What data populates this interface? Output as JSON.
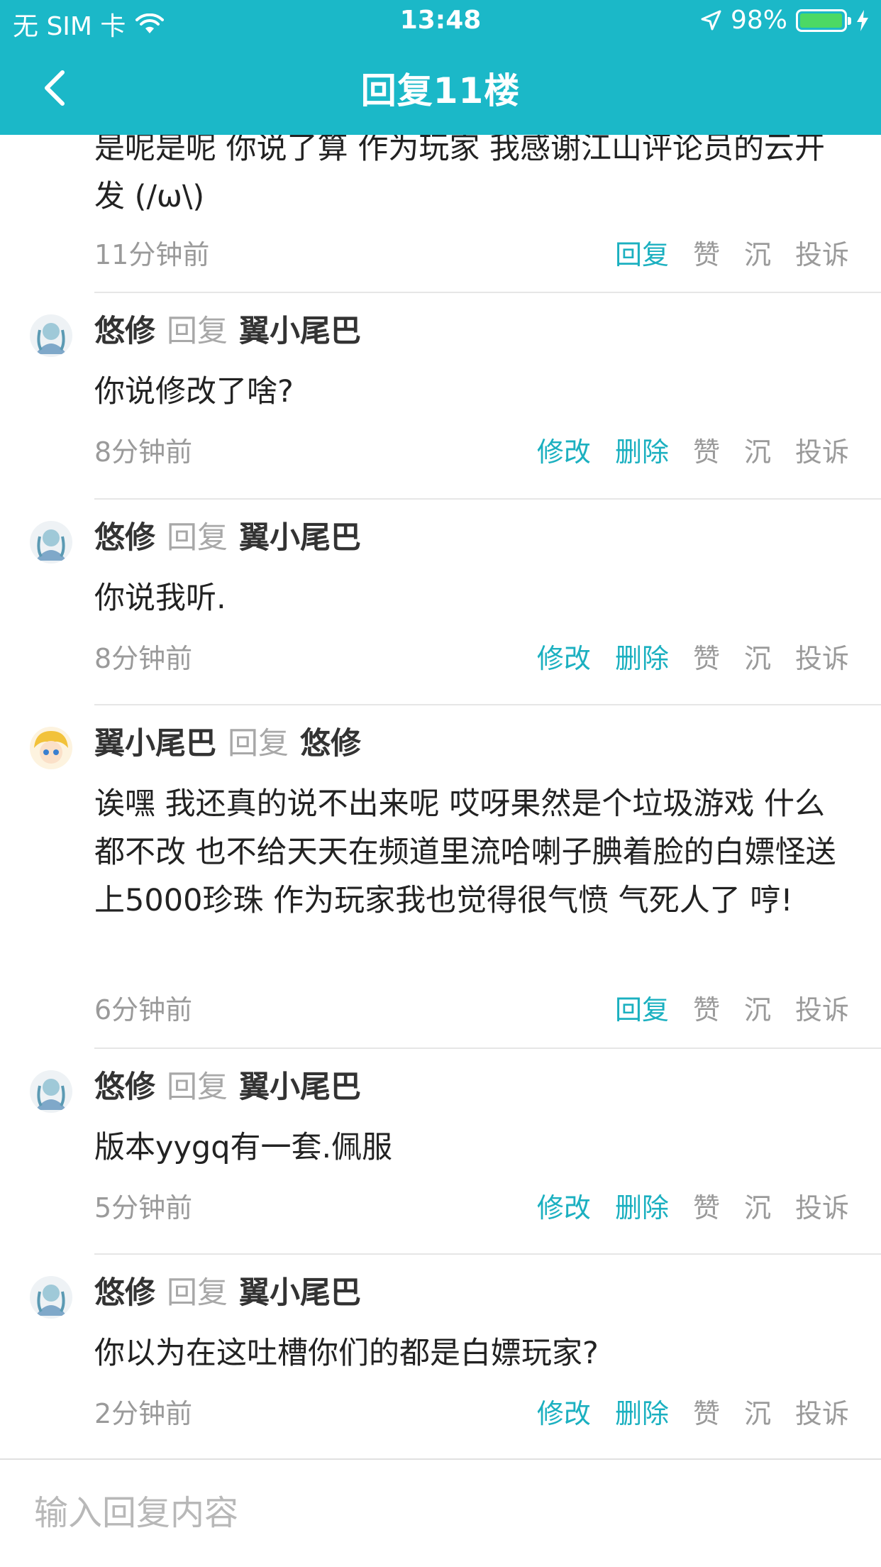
{
  "status_bar": {
    "carrier": "无 SIM 卡",
    "time": "13:48",
    "battery": "98%",
    "battery_fraction": 0.98
  },
  "nav": {
    "title": "回复11楼"
  },
  "partial_reply": {
    "text": "是呢是呢 你说了算 作为玩家 我感谢江山评论员的云开发 (/ω\\)",
    "time": "11分钟前",
    "actions": [
      "回复",
      "赞",
      "沉",
      "投诉"
    ]
  },
  "reply_word": "回复",
  "replies": [
    {
      "author": "悠修",
      "target": "翼小尾巴",
      "text": "你说修改了啥?",
      "time": "8分钟前",
      "actions": [
        "修改",
        "删除",
        "赞",
        "沉",
        "投诉"
      ]
    },
    {
      "author": "悠修",
      "target": "翼小尾巴",
      "text": "你说我听.",
      "time": "8分钟前",
      "actions": [
        "修改",
        "删除",
        "赞",
        "沉",
        "投诉"
      ]
    },
    {
      "author": "翼小尾巴",
      "target": "悠修",
      "text": "诶嘿 我还真的说不出来呢 哎呀果然是个垃圾游戏 什么都不改 也不给天天在频道里流哈喇子腆着脸的白嫖怪送上5000珍珠 作为玩家我也觉得很气愤 气死人了 哼!",
      "time": "6分钟前",
      "actions": [
        "回复",
        "赞",
        "沉",
        "投诉"
      ]
    },
    {
      "author": "悠修",
      "target": "翼小尾巴",
      "text": "版本yygq有一套.佩服",
      "time": "5分钟前",
      "actions": [
        "修改",
        "删除",
        "赞",
        "沉",
        "投诉"
      ]
    },
    {
      "author": "悠修",
      "target": "翼小尾巴",
      "text": "你以为在这吐槽你们的都是白嫖玩家?",
      "time": "2分钟前",
      "actions": [
        "修改",
        "删除",
        "赞",
        "沉",
        "投诉"
      ]
    }
  ],
  "input": {
    "placeholder": "输入回复内容"
  },
  "colors": {
    "header": "#1bb8c8",
    "accent": "#1bb0c0",
    "muted": "#9a9a9a"
  }
}
